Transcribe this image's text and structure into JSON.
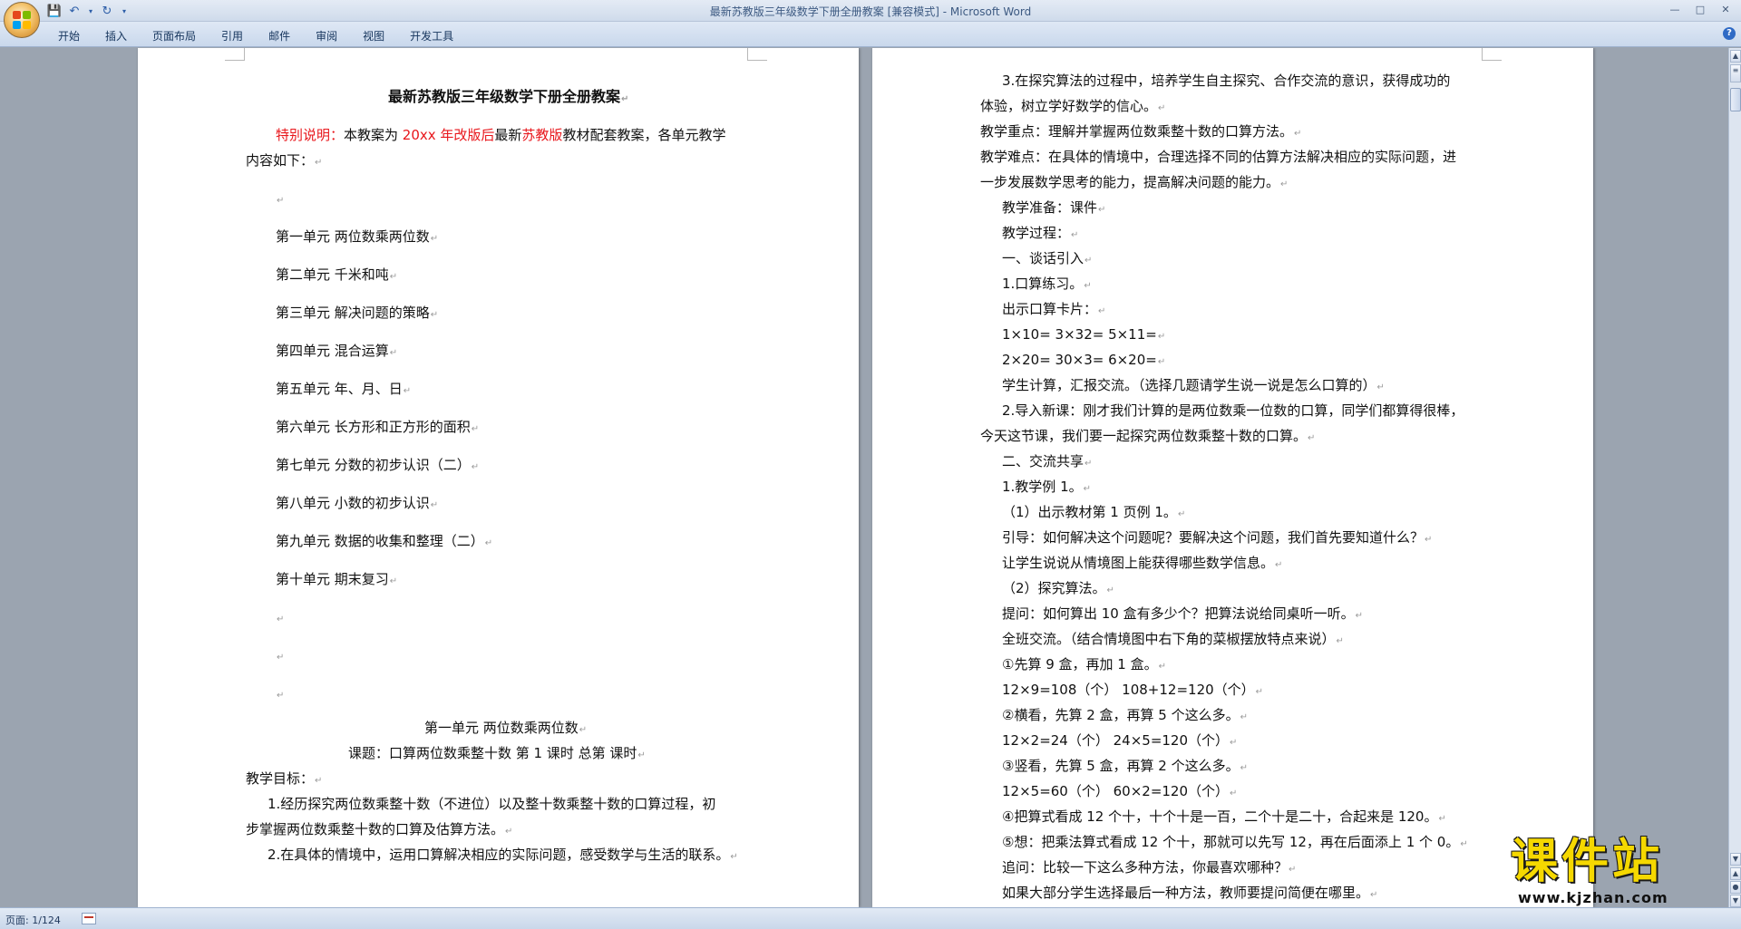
{
  "window": {
    "title": "最新苏教版三年级数学下册全册教案 [兼容模式]",
    "app_suffix": " - Microsoft Word",
    "controls": [
      "minimize",
      "maximize",
      "close"
    ]
  },
  "quick_access": [
    "save-icon",
    "undo-icon",
    "redo-icon"
  ],
  "ribbon": {
    "tabs": [
      "开始",
      "插入",
      "页面布局",
      "引用",
      "邮件",
      "审阅",
      "视图",
      "开发工具"
    ]
  },
  "page_left": {
    "title": "最新苏教版三年级数学下册全册教案",
    "note_prefix": "特别说明：",
    "note_a": "本教案为 ",
    "note_year": "20xx 年改版后",
    "note_b": "最新",
    "note_edition": "苏教版",
    "note_c": "教材配套教案，各单元教学",
    "note_line2": "内容如下：",
    "units": [
      "第一单元 两位数乘两位数",
      "第二单元 千米和吨",
      "第三单元 解决问题的策略",
      "第四单元 混合运算",
      "第五单元 年、月、日",
      "第六单元 长方形和正方形的面积",
      "第七单元 分数的初步认识（二）",
      "第八单元 小数的初步认识",
      "第九单元 数据的收集和整理（二）",
      "第十单元 期末复习"
    ],
    "section_title": "第一单元 两位数乘两位数",
    "lesson_title": "课题：口算两位数乘整十数 第 1 课时 总第 课时",
    "goals_label": "教学目标：",
    "goal1_a": "1.经历探究两位数乘整十数（不进位）以及整十数乘整十数的口算过程，初",
    "goal1_b": "步掌握两位数乘整十数的口算及估算方法。",
    "goal2": "2.在具体的情境中，运用口算解决相应的实际问题，感受数学与生活的联系。"
  },
  "page_right": {
    "lines": [
      "3.在探究算法的过程中，培养学生自主探究、合作交流的意识，获得成功的",
      "体验，树立学好数学的信心。",
      "教学重点：理解并掌握两位数乘整十数的口算方法。",
      "教学难点：在具体的情境中，合理选择不同的估算方法解决相应的实际问题，进",
      "一步发展数学思考的能力，提高解决问题的能力。",
      "教学准备：课件",
      "教学过程：",
      "一、谈话引入",
      "1.口算练习。",
      "出示口算卡片：",
      "1×10= 3×32= 5×11=",
      "2×20= 30×3= 6×20=",
      "学生计算，汇报交流。（选择几题请学生说一说是怎么口算的）",
      "2.导入新课：刚才我们计算的是两位数乘一位数的口算，同学们都算得很棒，",
      "今天这节课，我们要一起探究两位数乘整十数的口算。",
      "二、交流共享",
      "1.教学例 1。",
      "（1）出示教材第 1 页例 1。",
      "引导：如何解决这个问题呢？要解决这个问题，我们首先要知道什么？",
      "让学生说说从情境图上能获得哪些数学信息。",
      "（2）探究算法。",
      "提问：如何算出 10 盒有多少个？把算法说给同桌听一听。",
      "全班交流。（结合情境图中右下角的菜椒摆放特点来说）",
      "①先算 9 盒，再加 1 盒。",
      "12×9=108（个） 108+12=120（个）",
      "②横看，先算 2 盒，再算 5 个这么多。",
      "12×2=24（个） 24×5=120（个）",
      "③竖看，先算 5 盒，再算 2 个这么多。",
      "12×5=60（个） 60×2=120（个）",
      "④把算式看成 12 个十，十个十是一百，二个十是二十，合起来是 120。",
      "⑤想：把乘法算式看成 12 个十，那就可以先写 12，再在后面添上 1 个 0。",
      "追问：比较一下这么多种方法，你最喜欢哪种？",
      "如果大部分学生选择最后一种方法，教师要提问简便在哪里。"
    ]
  },
  "statusbar": {
    "page_info": "页面: 1/124"
  },
  "watermark": {
    "text": "课件站",
    "url": "www.kjzhan.com"
  },
  "colors": {
    "red_text": "#e8161b",
    "watermark_yellow": "#f5d800"
  }
}
